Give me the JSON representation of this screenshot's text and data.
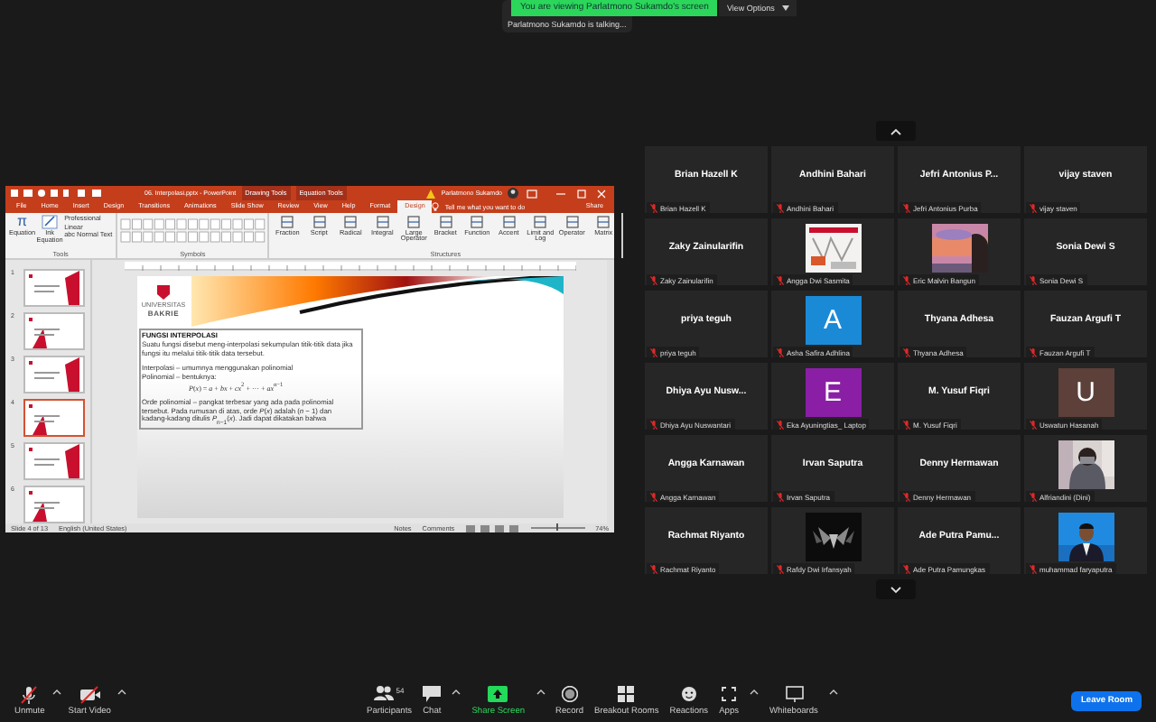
{
  "banner": {
    "text": "You are viewing Parlatmono Sukamdo's screen",
    "view_options": "View Options"
  },
  "talking": "Parlatmono Sukamdo is talking...",
  "powerpoint": {
    "title": "06. Interpolasi.pptx - PowerPoint",
    "context_tabs": [
      "Drawing Tools",
      "Equation Tools"
    ],
    "account": "Parlatmono Sukamdo",
    "tabs": [
      {
        "label": "File",
        "selected": false
      },
      {
        "label": "Home",
        "selected": false
      },
      {
        "label": "Insert",
        "selected": false
      },
      {
        "label": "Design",
        "selected": false
      },
      {
        "label": "Transitions",
        "selected": false
      },
      {
        "label": "Animations",
        "selected": false
      },
      {
        "label": "Slide Show",
        "selected": false
      },
      {
        "label": "Review",
        "selected": false
      },
      {
        "label": "View",
        "selected": false
      },
      {
        "label": "Help",
        "selected": false
      },
      {
        "label": "Format",
        "selected": false
      },
      {
        "label": "Design",
        "selected": true
      }
    ],
    "tell_me": "Tell me what you want to do",
    "share": "Share",
    "tools": {
      "label": "Tools",
      "glyph": "π",
      "big": [
        "Equation",
        "Ink Equation"
      ],
      "small": [
        "Professional",
        "Linear",
        "abc Normal Text"
      ]
    },
    "symbols_label": "Symbols",
    "structures": {
      "label": "Structures",
      "items": [
        "Fraction",
        "Script",
        "Radical",
        "Integral",
        "Large Operator",
        "Bracket",
        "Function",
        "Accent",
        "Limit and Log",
        "Operator",
        "Matrix"
      ]
    },
    "slides": [
      {
        "number": "1",
        "selected": false
      },
      {
        "number": "2",
        "selected": false
      },
      {
        "number": "3",
        "selected": false
      },
      {
        "number": "4",
        "selected": true
      },
      {
        "number": "5",
        "selected": false
      },
      {
        "number": "6",
        "selected": false
      }
    ],
    "slide": {
      "logo_top": "UNIVERSITAS",
      "logo": "BAKRIE",
      "heading": "FUNGSI INTERPOLASI",
      "paragraphs": [
        "Suatu fungsi disebut meng-interpolasi sekumpulan titik-titik data jika fungsi itu melalui titik-titik data tersebut.",
        "Interpolasi – umumnya menggunakan polinomial",
        "Polinomial – bentuknya:"
      ],
      "formula": "*P*(*x*) = *a* + *bx* + *cx*$^{2}$ + ··· + *ax*$^{n−1}$",
      "last": "Orde polinomial – pangkat terbesar yang ada pada polinomial tersebut. Pada rumusan di atas, orde *P*(*x*) adalah (*n* − 1) dan kadang-kadang ditulis *P*$_{n−1}$(*x*). Jadi dapat dikatakan bahwa"
    },
    "status": {
      "slide": "Slide 4 of 13",
      "language": "English (United States)",
      "notes": "Notes",
      "comments": "Comments",
      "zoom_slider": {
        "level": 0.5
      },
      "zoom": "74%"
    }
  },
  "gallery": [
    {
      "kind": "name",
      "name": "Brian Hazell K",
      "label": "Brian Hazell K"
    },
    {
      "kind": "name",
      "name": "Andhini Bahari",
      "label": "Andhini Bahari"
    },
    {
      "kind": "name",
      "name": "Jefri Antonius P...",
      "label": "Jefri Antonius Purba"
    },
    {
      "kind": "name",
      "name": "vijay staven",
      "label": "vijay staven"
    },
    {
      "kind": "name",
      "name": "Zaky Zainularifin",
      "label": "Zaky Zainularifin"
    },
    {
      "kind": "picture",
      "label": "Angga Dwi Sasmita"
    },
    {
      "kind": "picture",
      "label": "Eric Malvin Bangun"
    },
    {
      "kind": "name",
      "name": "Sonia Dewi S",
      "label": "Sonia Dewi S"
    },
    {
      "kind": "name",
      "name": "priya teguh",
      "label": "priya teguh"
    },
    {
      "kind": "avatar",
      "letter": "A",
      "color": "#1b8ad6",
      "label": "Asha Safira Adhlina"
    },
    {
      "kind": "name",
      "name": "Thyana Adhesa",
      "label": "Thyana Adhesa"
    },
    {
      "kind": "name",
      "name": "Fauzan Argufi T",
      "label": "Fauzan Argufi T"
    },
    {
      "kind": "name",
      "name": "Dhiya Ayu Nusw...",
      "label": "Dhiya Ayu Nuswantari"
    },
    {
      "kind": "avatar",
      "letter": "E",
      "color": "#8a1fa6",
      "label": "Eka Ayuningtias_ Laptop"
    },
    {
      "kind": "name",
      "name": "M. Yusuf Fiqri",
      "label": "M. Yusuf Fiqri"
    },
    {
      "kind": "avatar",
      "letter": "U",
      "color": "#5c4039",
      "label": "Uswatun Hasanah"
    },
    {
      "kind": "name",
      "name": "Angga Karnawan",
      "label": "Angga Karnawan"
    },
    {
      "kind": "name",
      "name": "Irvan Saputra",
      "label": "Irvan Saputra"
    },
    {
      "kind": "name",
      "name": "Denny Hermawan",
      "label": "Denny Hermawan"
    },
    {
      "kind": "picture",
      "label": "Alfriandini (Dini)"
    },
    {
      "kind": "name",
      "name": "Rachmat Riyanto",
      "label": "Rachmat Riyanto"
    },
    {
      "kind": "picture",
      "label": "Rafdy Dwi Irfansyah"
    },
    {
      "kind": "name",
      "name": "Ade Putra Pamu...",
      "label": "Ade Putra Pamungkas"
    },
    {
      "kind": "picture",
      "label": "muhammad faryaputra"
    }
  ],
  "toolbar": {
    "left": [
      "Unmute",
      "Start Video"
    ],
    "participants_count": "54",
    "center": [
      "Participants",
      "Chat",
      "Share Screen",
      "Record",
      "Breakout Rooms",
      "Reactions",
      "Apps",
      "Whiteboards"
    ],
    "leave": "Leave Room"
  }
}
